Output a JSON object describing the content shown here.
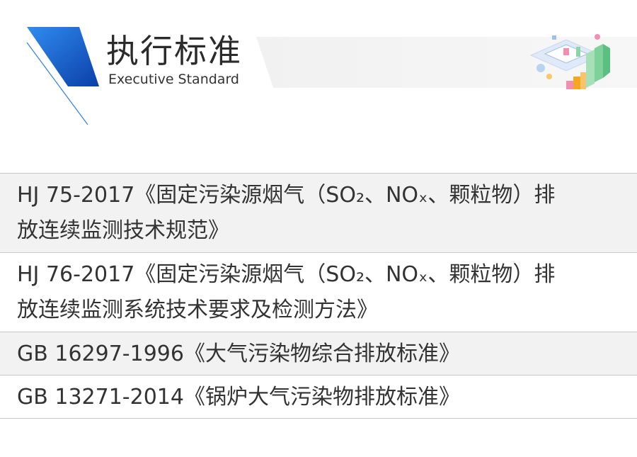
{
  "header": {
    "title_zh": "执行标准",
    "title_en": "Executive Standard",
    "illustration_icon": "data-dashboard-illustration-icon"
  },
  "colors": {
    "accent_blue": "#1a6fd6",
    "accent_blue_dark": "#0b3fa8",
    "band_gray": "#efefef",
    "row_shade": "#f2f2f2",
    "divider": "#c8c8c8"
  },
  "standards": [
    {
      "lines": [
        "HJ 75-2017《固定污染源烟气（SO₂、NOₓ、颗粒物）排",
        "放连续监测技术规范》"
      ],
      "shaded": true
    },
    {
      "lines": [
        "HJ 76-2017《固定污染源烟气（SO₂、NOₓ、颗粒物）排",
        "放连续监测系统技术要求及检测方法》"
      ],
      "shaded": false
    },
    {
      "lines": [
        "GB 16297-1996《大气污染物综合排放标准》"
      ],
      "shaded": true
    },
    {
      "lines": [
        "GB 13271-2014《锅炉大气污染物排放标准》"
      ],
      "shaded": false
    }
  ]
}
